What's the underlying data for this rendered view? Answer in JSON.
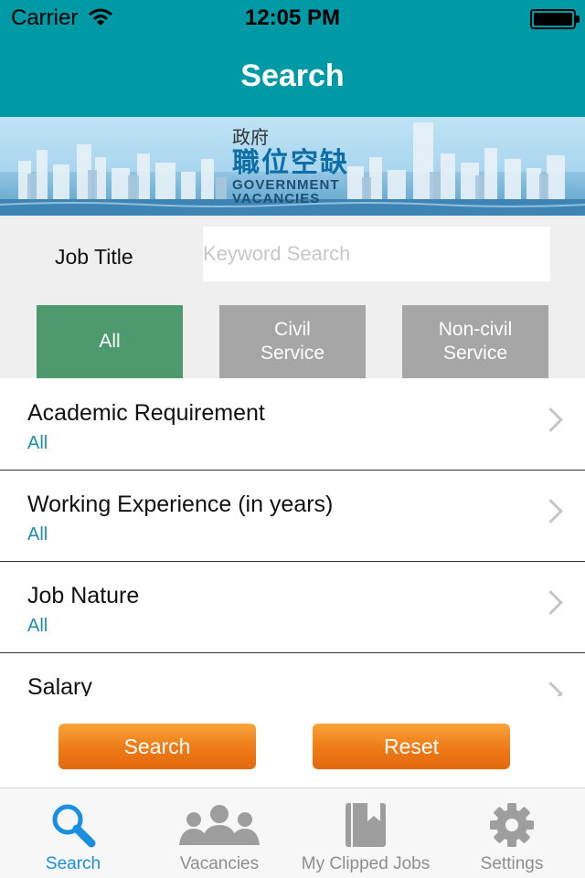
{
  "status_bar": {
    "carrier": "Carrier",
    "time": "12:05 PM"
  },
  "nav": {
    "title": "Search"
  },
  "banner": {
    "zh_line1": "政府",
    "zh_line2": "職位空缺",
    "en_line1": "GOVERNMENT",
    "en_line2": "VACANCIES"
  },
  "search": {
    "job_title_label": "Job Title",
    "keyword_placeholder": "Keyword Search",
    "segments": [
      {
        "label": "All",
        "selected": true
      },
      {
        "label": "Civil Service",
        "selected": false
      },
      {
        "label": "Non-civil Service",
        "selected": false
      }
    ]
  },
  "filters": [
    {
      "label": "Academic Requirement",
      "value": "All"
    },
    {
      "label": "Working Experience (in years)",
      "value": "All"
    },
    {
      "label": "Job Nature",
      "value": "All"
    },
    {
      "label": "Salary",
      "value": ""
    }
  ],
  "actions": {
    "search_label": "Search",
    "reset_label": "Reset"
  },
  "tabs": [
    {
      "label": "Search",
      "icon": "search-icon",
      "active": true
    },
    {
      "label": "Vacancies",
      "icon": "people-icon",
      "active": false
    },
    {
      "label": "My Clipped Jobs",
      "icon": "bookmark-book-icon",
      "active": false
    },
    {
      "label": "Settings",
      "icon": "gear-icon",
      "active": false
    }
  ],
  "colors": {
    "teal": "#0099a6",
    "selected_green": "#4c9a6d",
    "unselected_gray": "#a6a6a6",
    "accent_blue": "#1a8fe0",
    "orange": "#ee7a16",
    "value_teal": "#1a8fb0"
  }
}
